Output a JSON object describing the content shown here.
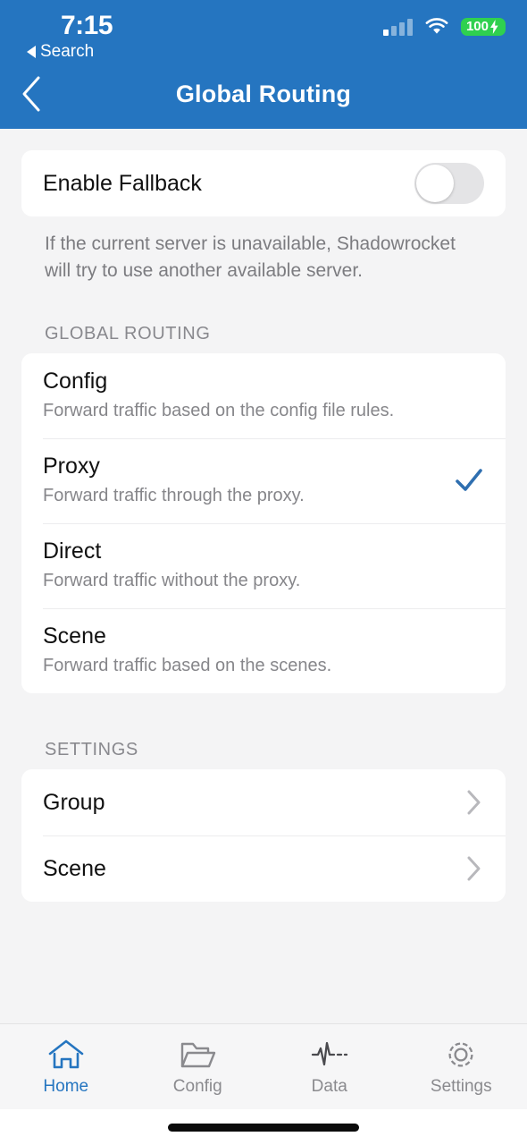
{
  "statusbar": {
    "time": "7:15",
    "back_app_label": "Search",
    "battery_level": "100",
    "battery_charging_icon": "lightning-bolt-icon",
    "cellular_icon": "cellular-signal-icon",
    "wifi_icon": "wifi-icon"
  },
  "navbar": {
    "title": "Global Routing",
    "back_icon": "chevron-left-icon",
    "accent_color": "#2575c0"
  },
  "fallback": {
    "label": "Enable Fallback",
    "enabled": false,
    "description": "If the current server is unavailable, Shadowrocket will try to use another available server."
  },
  "global_routing": {
    "header": "GLOBAL ROUTING",
    "selected": "Proxy",
    "check_color": "#2f6fb0",
    "options": [
      {
        "title": "Config",
        "subtitle": "Forward traffic based on the config file rules.",
        "checked": false
      },
      {
        "title": "Proxy",
        "subtitle": "Forward traffic through the proxy.",
        "checked": true
      },
      {
        "title": "Direct",
        "subtitle": "Forward traffic without the proxy.",
        "checked": false
      },
      {
        "title": "Scene",
        "subtitle": "Forward traffic based on the scenes.",
        "checked": false
      }
    ]
  },
  "settings": {
    "header": "SETTINGS",
    "items": [
      {
        "label": "Group",
        "icon": "chevron-right-icon"
      },
      {
        "label": "Scene",
        "icon": "chevron-right-icon"
      }
    ]
  },
  "tabbar": {
    "active": "Home",
    "tabs": [
      {
        "label": "Home",
        "icon": "house-icon"
      },
      {
        "label": "Config",
        "icon": "folder-icon"
      },
      {
        "label": "Data",
        "icon": "waveform-icon"
      },
      {
        "label": "Settings",
        "icon": "gear-icon"
      }
    ]
  }
}
